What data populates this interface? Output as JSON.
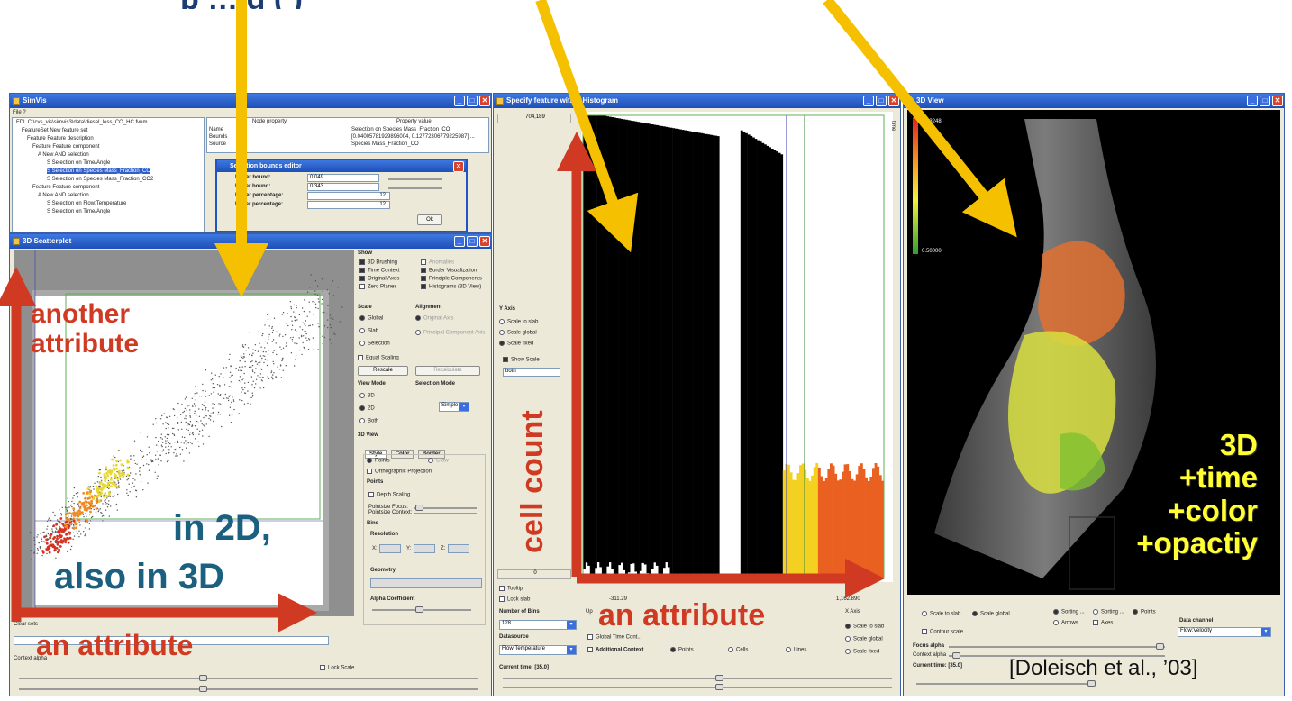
{
  "header": {
    "fragment_text": "p …   g   (  )"
  },
  "colors": {
    "arrow_yellow": "#f5c000",
    "arrow_red": "#d03a22",
    "label_red": "#d03a22",
    "label_teal": "#1c6080",
    "label_yellow": "#ffff33"
  },
  "simvis": {
    "title": "SimVis",
    "menu": "File  ?",
    "tree": [
      "FDL C:\\cvs_vis\\simvis3\\data\\diesel_less_CO_HC.fvum",
      "FeatureSet New feature set",
      "Feature Feature description",
      "Feature Feature component",
      "A New AND selection",
      "S Selection on Time/Angle",
      "S Selection on Species Mass_Fraction_CO",
      "S Selection on Species Mass_Fraction_CO2",
      "Feature Feature component",
      "A New AND selection",
      "S Selection on Flow:Temperature",
      "S Selection on Time/Angle"
    ],
    "prop_header": [
      "Node property",
      "Property value"
    ],
    "props": [
      [
        "Name",
        "Selection on Species Mass_Fraction_CO"
      ],
      [
        "Bounds",
        "[0.04005781929896004, 0.12772306779225987] ..."
      ],
      [
        "Source",
        "Species Mass_Fraction_CO"
      ]
    ],
    "bounds_editor": {
      "title": "Selection bounds editor",
      "rows": [
        {
          "label": "Lower bound:",
          "value": "0.049"
        },
        {
          "label": "Upper bound:",
          "value": "0.343"
        },
        {
          "label": "Lower percentage:",
          "value": "12"
        },
        {
          "label": "Upper percentage:",
          "value": "12"
        }
      ],
      "ok": "Ok"
    }
  },
  "scatter": {
    "title": "3D Scatterplot",
    "show_label": "Show",
    "show_left": [
      "3D Brushing",
      "Time Context",
      "Original Axes",
      "Zero Planes"
    ],
    "show_right": [
      "Anomalies",
      "Border Visualization",
      "Principle Components",
      "Histograms (3D View)"
    ],
    "scale_label": "Scale",
    "scale_opts": [
      "Global",
      "Slab",
      "Selection"
    ],
    "alignment_label": "Alignment",
    "alignment_opts": [
      "Original Axis",
      "Principal Component Axis"
    ],
    "equal_scaling": "Equal Scaling",
    "rescale": "Rescale",
    "recalculate": "Recalculate",
    "view_mode_label": "View Mode",
    "view_opts": [
      "3D",
      "2D",
      "Both"
    ],
    "selection_mode_label": "Selection Mode",
    "selection_mode_value": "Simple",
    "view3d_label": "3D View",
    "tabs": [
      "Style",
      "Color",
      "Border"
    ],
    "style_opts": [
      "Points",
      "Glow"
    ],
    "ortho": "Orthographic Projection",
    "points_label": "Points",
    "depth_scaling": "Depth Scaling",
    "pointsize_focus": "Pointsize Focus:",
    "pointsize_context": "Pointsize Context:",
    "bins_label": "Bins",
    "resolution_label": "Resolution",
    "res_axes": [
      "X:",
      "Y:",
      "Z:"
    ],
    "geometry_label": "Geometry",
    "alpha_label": "Alpha Coefficient",
    "clear_label": "Clear sets",
    "context_label": "Context alpha",
    "lock_scale": "Lock Scale"
  },
  "histogram": {
    "title": "Specify feature with a Histogram",
    "top_value": "704,189",
    "bottom_value": "0",
    "x_min": "-311.29",
    "x_max": "1,162.890",
    "time_axis": "time",
    "y_axis_label": "Y Axis",
    "y_axis_opts": [
      "Scale to slab",
      "Scale global",
      "Scale fixed"
    ],
    "show_scale": "Show Scale",
    "scale_select": "both",
    "tooltip": "Tooltip",
    "lock_slab": "Lock slab",
    "num_bins_label": "Number of Bins",
    "num_bins_value": "128",
    "datasource_label": "Datasource",
    "datasource_value": "Flow:Temperature",
    "global_time": "Global Time Cont...",
    "additional_context": "Additional Context",
    "opts_bottom": [
      "Points",
      "Cells",
      "Lines"
    ],
    "x_axis_label": "X Axis",
    "x_axis_opts": [
      "Scale to slab",
      "Scale global",
      "Scale fixed"
    ],
    "current_time": "Current time: [35.0]",
    "up_label": "Up"
  },
  "view3d": {
    "title": "3D View",
    "colorbar_top": "0.03248",
    "colorbar_bottom": "0.50000",
    "opts_row1": [
      "Scale to slab",
      "Scale global"
    ],
    "opts_row2": [
      "Sorting ...",
      "Sorting ...",
      "Points"
    ],
    "opts_row3": [
      "Arrows",
      "Axes"
    ],
    "contour": "Contour scale",
    "data_channel_label": "Data channel",
    "data_channel_value": "Flow:Velocity",
    "focus_alpha": "Focus alpha",
    "context_alpha": "Context alpha",
    "current_time": "Current time: [35.0]"
  },
  "annotations": {
    "another_attribute": "another\nattribute",
    "an_attribute_left": "an attribute",
    "in_2d": "in 2D,",
    "also_3d": "also in 3D",
    "cell_count": "cell count",
    "an_attribute_mid": "an attribute",
    "three_d": "3D\n+time\n+color\n+opactiy",
    "citation": "[Doleisch et al., ’03]"
  }
}
